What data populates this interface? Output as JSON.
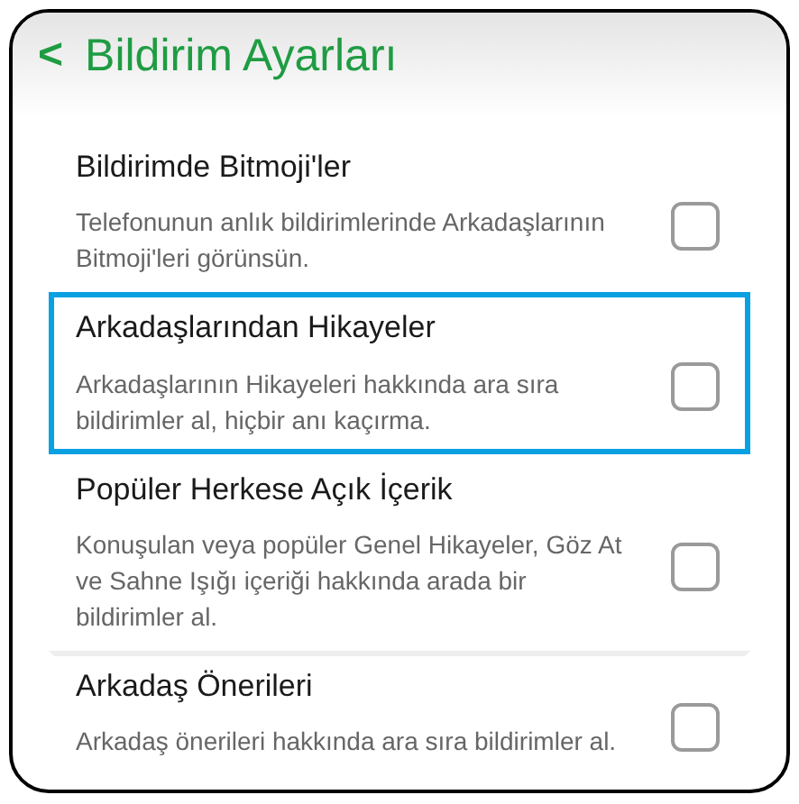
{
  "header": {
    "back": "<",
    "title": "Bildirim Ayarları"
  },
  "settings": [
    {
      "title": "Bildirimde Bitmoji'ler",
      "description": "Telefonunun anlık bildirimlerinde Arkadaşlarının Bitmoji'leri görünsün.",
      "checked": false,
      "highlighted": false
    },
    {
      "title": "Arkadaşlarından Hikayeler",
      "description": "Arkadaşlarının Hikayeleri hakkında ara sıra bildirimler al, hiçbir anı kaçırma.",
      "checked": false,
      "highlighted": true
    },
    {
      "title": "Popüler Herkese Açık İçerik",
      "description": "Konuşulan veya popüler Genel Hikayeler, Göz At ve Sahne Işığı içeriği hakkında arada bir bildirimler al.",
      "checked": false,
      "highlighted": false
    },
    {
      "title": "Arkadaş Önerileri",
      "description": "Arkadaş önerileri hakkında ara sıra bildirimler al.",
      "checked": false,
      "highlighted": false
    }
  ]
}
